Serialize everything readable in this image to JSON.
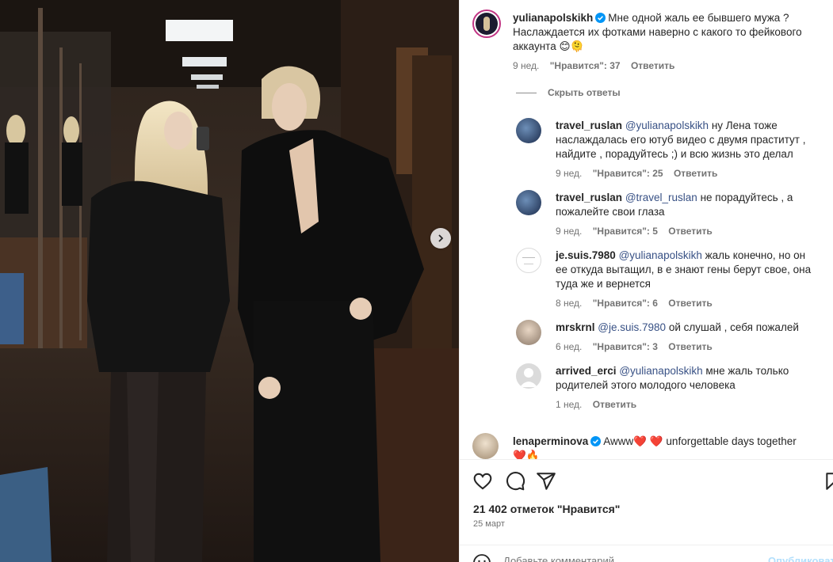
{
  "post": {
    "author": "yulianapolskikh",
    "caption": "Мне одной жаль ее бывшего мужа ? Наслаждается их фотками наверно с какого то фейкового аккаунта 😊🫠",
    "caption_line1": "Мне одной жаль ее бывшего мужа ?",
    "caption_line2": "Наслаждается их фотками наверно с какого то фейкового",
    "caption_line3": "аккаунта 😊🫠",
    "time": "9 нед.",
    "likes": "\"Нравится\": 37",
    "reply": "Ответить"
  },
  "hide_replies": "Скрыть ответы",
  "replies": [
    {
      "author": "travel_ruslan",
      "mention": "@yulianapolskikh",
      "lines": [
        "ну Лена тоже",
        "наслаждалась его ютуб видео с двумя праститут ,",
        "найдите , порадуйтесь ;) и всю жизнь это делал"
      ],
      "time": "9 нед.",
      "likes": "\"Нравится\": 25",
      "reply": "Ответить"
    },
    {
      "author": "travel_ruslan",
      "mention": "@travel_ruslan",
      "lines": [
        "не порадуйтесь , а",
        "пожалейте свои глаза"
      ],
      "time": "9 нед.",
      "likes": "\"Нравится\": 5",
      "reply": "Ответить"
    },
    {
      "author": "je.suis.7980",
      "mention": "@yulianapolskikh",
      "lines": [
        "жаль конечно, но он",
        "ее откуда вытащил, в е знают гены берут свое, она",
        "туда же и вернется"
      ],
      "time": "8 нед.",
      "likes": "\"Нравится\": 6",
      "reply": "Ответить"
    },
    {
      "author": "mrskrnl",
      "mention": "@je.suis.7980",
      "lines": [
        "ой слушай , себя пожалей"
      ],
      "time": "6 нед.",
      "likes": "\"Нравится\": 3",
      "reply": "Ответить"
    },
    {
      "author": "arrived_erci",
      "mention": "@yulianapolskikh",
      "lines": [
        "мне жаль только",
        "родителей этого молодого человека"
      ],
      "time": "1 нед.",
      "likes": "",
      "reply": "Ответить"
    }
  ],
  "next_comment": {
    "author": "lenaperminova",
    "text1": "Awww❤️ ❤️ unforgettable days together",
    "text2": "❤️🔥"
  },
  "actions": {
    "likes_count": "21 402 отметок \"Нравится\"",
    "date": "25 март",
    "add_comment_placeholder": "Добавьте комментарий...",
    "publish": "Опубликовать"
  },
  "icons": [
    "chevron-right-icon",
    "verified-icon",
    "heart-icon",
    "comment-icon",
    "share-icon",
    "bookmark-icon",
    "emoji-icon"
  ],
  "colors": {
    "accent": "#0095f6",
    "mention": "#385185",
    "verified": "#0095f6",
    "muted": "#737373"
  }
}
